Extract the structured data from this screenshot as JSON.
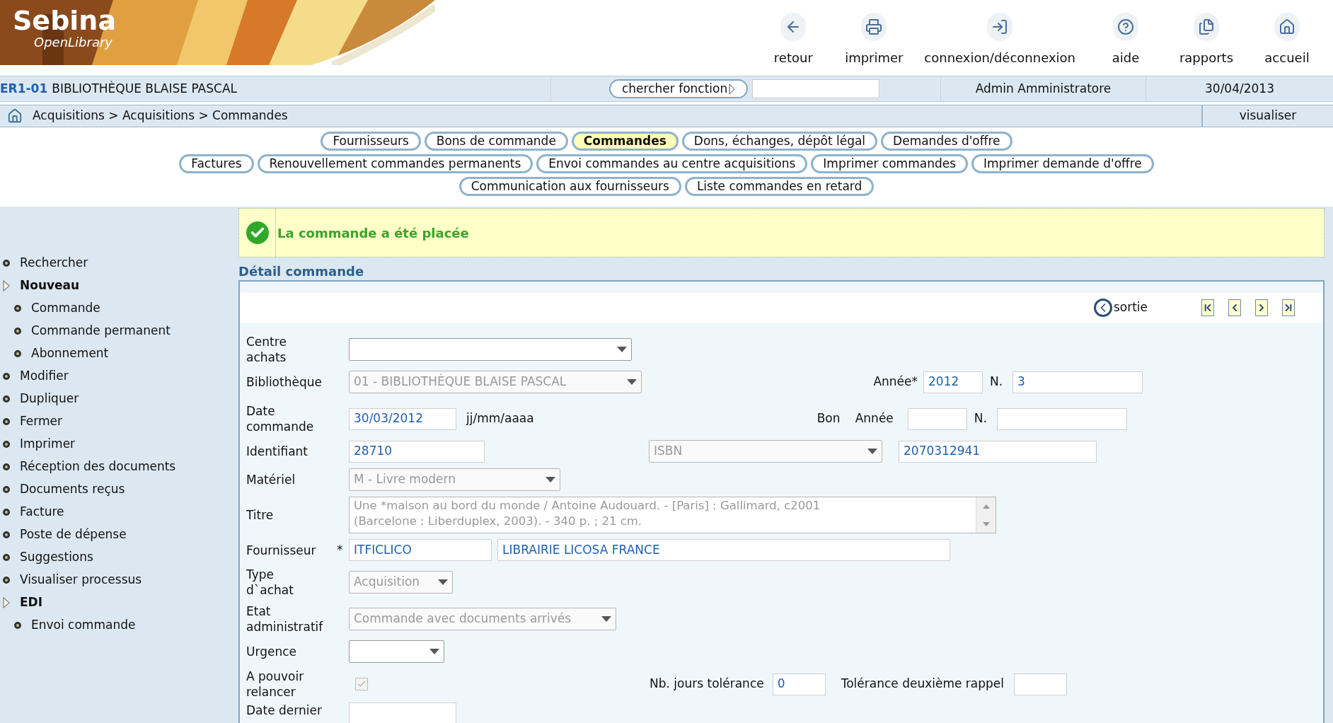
{
  "header": {
    "logo": {
      "title": "Sebina",
      "subtitle": "OpenLibrary"
    },
    "toolbar": [
      {
        "label": "retour",
        "kind": "back"
      },
      {
        "label": "imprimer",
        "kind": "print"
      },
      {
        "label": "connexion/déconnexion",
        "kind": "login"
      },
      {
        "label": "aide",
        "kind": "help"
      },
      {
        "label": "rapports",
        "kind": "reports"
      },
      {
        "label": "accueil",
        "kind": "home"
      }
    ]
  },
  "info_bar": {
    "code": "ER1-01",
    "library": "BIBLIOTHÈQUE BLAISE PASCAL",
    "search_button": "chercher fonction",
    "user": "Admin Amministratore",
    "date": "30/04/2013"
  },
  "breadcrumb": {
    "path": "Acquisitions > Acquisitions > Commandes",
    "action": "visualiser"
  },
  "tabs": [
    [
      {
        "label": "Fournisseurs",
        "selected": false
      },
      {
        "label": "Bons de commande",
        "selected": false
      },
      {
        "label": "Commandes",
        "selected": true
      },
      {
        "label": "Dons, échanges, dépôt légal",
        "selected": false
      },
      {
        "label": "Demandes d'offre",
        "selected": false
      }
    ],
    [
      {
        "label": "Factures",
        "selected": false
      },
      {
        "label": "Renouvellement commandes permanents",
        "selected": false
      },
      {
        "label": "Envoi commandes au centre acquisitions",
        "selected": false
      },
      {
        "label": "Imprimer commandes",
        "selected": false
      },
      {
        "label": "Imprimer demande d'offre",
        "selected": false
      }
    ],
    [
      {
        "label": "Communication aux fournisseurs",
        "selected": false
      },
      {
        "label": "Liste commandes en retard",
        "selected": false
      }
    ]
  ],
  "sidebar": {
    "items": [
      {
        "label": "Rechercher"
      },
      {
        "label": "Nouveau",
        "children": [
          {
            "label": "Commande"
          },
          {
            "label": "Commande permanent"
          },
          {
            "label": "Abonnement"
          }
        ]
      },
      {
        "label": "Modifier"
      },
      {
        "label": "Dupliquer"
      },
      {
        "label": "Fermer"
      },
      {
        "label": "Imprimer"
      },
      {
        "label": "Réception des documents"
      },
      {
        "label": "Documents reçus"
      },
      {
        "label": "Facture"
      },
      {
        "label": "Poste de dépense"
      },
      {
        "label": "Suggestions"
      },
      {
        "label": "Visualiser processus"
      },
      {
        "label": "EDI",
        "children": [
          {
            "label": "Envoi commande"
          }
        ]
      }
    ]
  },
  "message": {
    "text": "La commande a été placée"
  },
  "detail": {
    "title": "Détail commande",
    "exit": "sortie",
    "centre_achats": {
      "label": "Centre achats"
    },
    "bibliotheque": {
      "label": "Bibliothèque",
      "value": "01 - BIBLIOTHÈQUE BLAISE PASCAL",
      "disabled": true
    },
    "annee": {
      "label": "Année*",
      "value": "2012"
    },
    "numero": {
      "label": "N.",
      "value": "3"
    },
    "date_commande": {
      "label": "Date commande",
      "value": "30/03/2012",
      "hint": "jj/mm/aaaa"
    },
    "bon": {
      "label": "Bon",
      "year_label": "Année",
      "number_label": "N."
    },
    "identifiant": {
      "label": "Identifiant",
      "value": "28710",
      "id_type": "ISBN",
      "id_type_disabled": true,
      "id_value": "2070312941"
    },
    "materiel": {
      "label": "Matériel",
      "value": "M - Livre modern",
      "disabled": true
    },
    "titre": {
      "label": "Titre",
      "lines": [
        "Une *maison au bord du monde / Antoine Audouard. - [Paris] : Gallimard, c2001",
        "(Barcelone : Liberduplex, 2003). - 340 p. ; 21 cm."
      ],
      "disabled": true
    },
    "fournisseur": {
      "label": "Fournisseur",
      "required_mark": "*",
      "code": "ITFICLICO",
      "name": "LIBRAIRIE LICOSA FRANCE"
    },
    "type_achat": {
      "label": "Type d`achat",
      "value": "Acquisition",
      "disabled": true
    },
    "etat": {
      "label": "Etat administratif",
      "value": "Commande avec documents arrivés",
      "disabled": true
    },
    "urgence": {
      "label": "Urgence"
    },
    "relancer": {
      "label": "A pouvoir relancer",
      "checked": true,
      "disabled": true
    },
    "tolerance": {
      "label": "Nb. jours tolérance",
      "value": "0"
    },
    "tolerance_2": {
      "label": "Tolérance deuxième rappel"
    },
    "date_dernier": {
      "label": "Date dernier"
    }
  }
}
